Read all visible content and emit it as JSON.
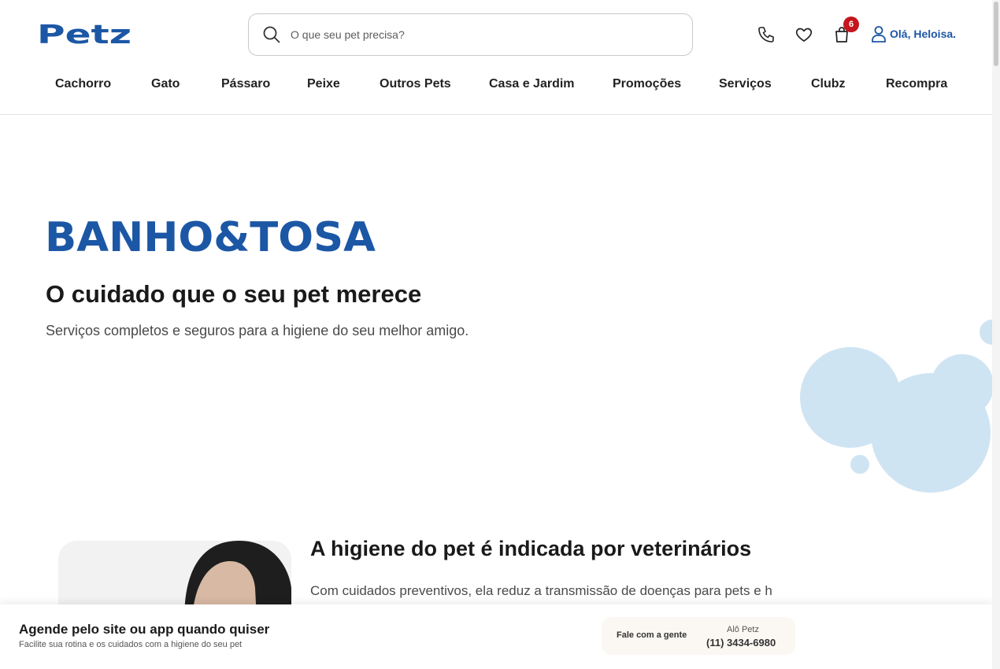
{
  "header": {
    "logo_text": "Petz",
    "search": {
      "placeholder": "O que seu pet precisa?"
    },
    "cart_count": "6",
    "user_greeting": "Olá, Heloisa."
  },
  "nav": {
    "items": [
      {
        "label": "Cachorro"
      },
      {
        "label": "Gato"
      },
      {
        "label": "Pássaro"
      },
      {
        "label": "Peixe"
      },
      {
        "label": "Outros Pets"
      },
      {
        "label": "Casa e Jardim"
      },
      {
        "label": "Promoções"
      },
      {
        "label": "Serviços"
      },
      {
        "label": "Clubz"
      },
      {
        "label": "Recompra"
      }
    ]
  },
  "hero": {
    "logo_text": "BANHO&TOSA",
    "title": "O cuidado que o seu pet merece",
    "subtitle": "Serviços completos e seguros para a higiene do seu melhor amigo."
  },
  "section": {
    "title": "A higiene do pet é indicada por veterinários",
    "text": "Com cuidados preventivos, ela reduz a transmissão de doenças para pets e h"
  },
  "bottom_bar": {
    "title": "Agende pelo site ou app quando quiser",
    "subtitle": "Facilite sua rotina e os cuidados com a higiene do seu pet",
    "contact_label": "Fale com a gente",
    "contact_name": "Alô Petz",
    "contact_phone": "(11) 3434-6980"
  },
  "colors": {
    "brand_blue": "#1c57a5",
    "badge_red": "#c4161c",
    "bubble_blue": "#cfe4f3"
  }
}
